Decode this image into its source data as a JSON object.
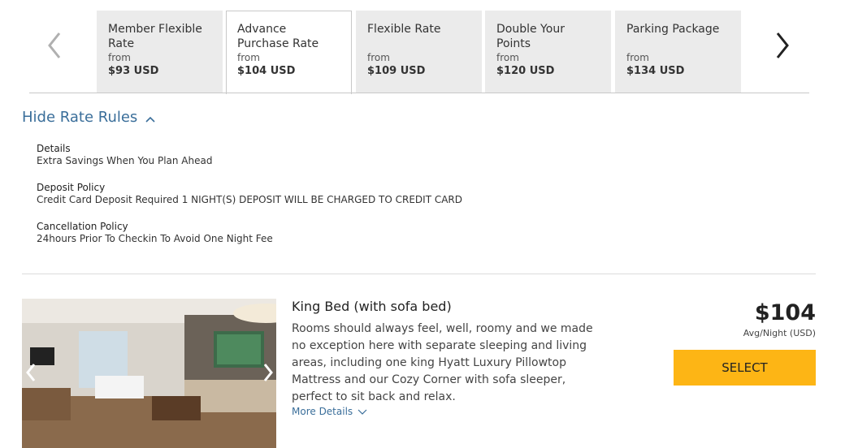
{
  "rate_tabs": [
    {
      "name": "Member Flexible Rate",
      "from": "from",
      "price": "$93 USD"
    },
    {
      "name": "Advance Purchase Rate",
      "from": "from",
      "price": "$104 USD"
    },
    {
      "name": "Flexible Rate",
      "from": "from",
      "price": "$109 USD"
    },
    {
      "name": "Double Your Points",
      "from": "from",
      "price": "$120 USD"
    },
    {
      "name": "Parking Package",
      "from": "from",
      "price": "$134 USD"
    }
  ],
  "active_tab": 1,
  "rules": {
    "toggle_label": "Hide Rate Rules",
    "details_title": "Details",
    "details_text": "Extra Savings When You Plan Ahead",
    "deposit_title": "Deposit Policy",
    "deposit_text": "Credit Card Deposit Required 1 NIGHT(S) DEPOSIT WILL BE CHARGED TO CREDIT CARD",
    "cancel_title": "Cancellation Policy",
    "cancel_text": "24hours Prior To Checkin To Avoid One Night Fee"
  },
  "room": {
    "title": "King Bed (with sofa bed)",
    "description": "Rooms should always feel, well, roomy and we made no exception here with separate sleeping and living areas, including one king Hyatt Luxury Pillowtop Mattress and our Cozy Corner with sofa sleeper, perfect to sit back and relax.",
    "more_details": "More Details",
    "price": "$104",
    "price_sub": "Avg/Night (USD)",
    "select_label": "SELECT"
  },
  "colors": {
    "accent_link": "#3a6e9a",
    "select_button": "#fdb515",
    "tab_bg": "#ebebeb"
  }
}
